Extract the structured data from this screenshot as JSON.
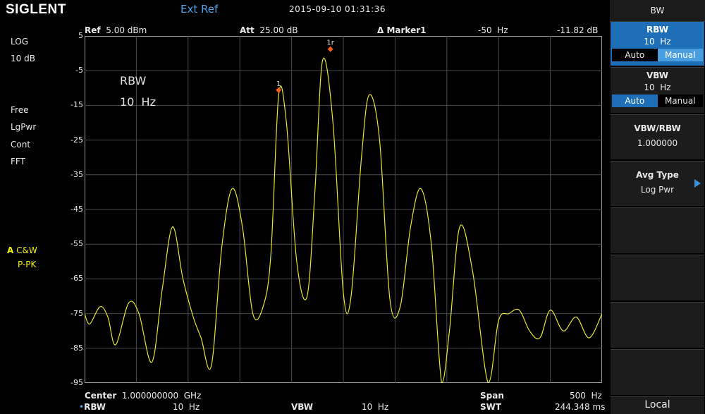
{
  "header": {
    "logo": "SIGLENT",
    "ref_source": "Ext Ref",
    "datetime": "2015-09-10   01:31:36"
  },
  "info_bar": {
    "ref_label": "Ref",
    "ref_value": "5.00 dBm",
    "att_label": "Att",
    "att_value": "25.00 dB",
    "marker_label": "Δ Marker1",
    "marker_freq": "-50  Hz",
    "marker_amp": "-11.82 dB"
  },
  "left_panel": {
    "scale_type": "LOG",
    "scale_div": "10 dB",
    "trig": "Free",
    "det": "LgPwr",
    "sweep": "Cont",
    "mode": "FFT",
    "trace_letter": "A",
    "trace_mode": "C&W",
    "trace_det": "P-PK"
  },
  "plot_overlay": {
    "rbw_label": "RBW",
    "rbw_value": "10  Hz"
  },
  "chart_data": {
    "type": "line",
    "ylabel": "",
    "xlabel": "",
    "yticks": [
      "5",
      "-5",
      "-15",
      "-25",
      "-35",
      "-45",
      "-55",
      "-65",
      "-75",
      "-85",
      "-95"
    ],
    "ylim": [
      -95,
      5
    ],
    "xlim": [
      0,
      10
    ],
    "grid": true,
    "series": [
      {
        "color": "#e6e62a",
        "x": [
          0,
          0.1,
          0.3,
          0.45,
          0.6,
          0.85,
          1.05,
          1.3,
          1.5,
          1.7,
          1.9,
          2.1,
          2.25,
          2.45,
          2.65,
          2.85,
          3.05,
          3.25,
          3.45,
          3.6,
          3.75,
          3.9,
          4.1,
          4.3,
          4.45,
          4.6,
          4.8,
          5,
          5.15,
          5.35,
          5.5,
          5.7,
          5.9,
          6.1,
          6.3,
          6.5,
          6.7,
          6.9,
          7.05,
          7.25,
          7.5,
          7.8,
          8.0,
          8.2,
          8.4,
          8.6,
          8.8,
          9.0,
          9.25,
          9.5,
          9.75,
          10
        ],
        "y": [
          -75,
          -78,
          -73,
          -76,
          -84,
          -72,
          -75,
          -89,
          -68,
          -50,
          -65,
          -76,
          -82,
          -90,
          -56,
          -39,
          -50,
          -75,
          -73,
          -58,
          -12,
          -20,
          -60,
          -70,
          -40,
          -2,
          -20,
          -69,
          -70,
          -30,
          -12,
          -25,
          -71,
          -73,
          -50,
          -39,
          -55,
          -99,
          -80,
          -50,
          -63,
          -99,
          -77,
          -75,
          -74,
          -80,
          -82,
          -74,
          -80,
          -76,
          -82,
          -75
        ]
      }
    ],
    "markers": [
      {
        "label": "1",
        "x": 3.75,
        "y": -11.82
      },
      {
        "label": "1r",
        "x": 4.75,
        "y": 0.0
      }
    ]
  },
  "bottom_bar": {
    "center_label": "Center",
    "center_value": "1.000000000  GHz",
    "span_label": "Span",
    "span_value": "500  Hz",
    "rbw_label": "RBW",
    "rbw_value": "10  Hz",
    "vbw_label": "VBW",
    "vbw_value": "10  Hz",
    "swt_label": "SWT",
    "swt_value": "244.348 ms"
  },
  "softkeys": {
    "menu_title": "BW",
    "rbw_title": "RBW",
    "rbw_value": "10  Hz",
    "rbw_auto": "Auto",
    "rbw_manual": "Manual",
    "vbw_title": "VBW",
    "vbw_value": "10  Hz",
    "vbw_auto": "Auto",
    "vbw_manual": "Manual",
    "ratio_title": "VBW/RBW",
    "ratio_value": "1.000000",
    "avg_title": "Avg Type",
    "avg_value": "Log Pwr",
    "local": "Local"
  },
  "colors": {
    "accent": "#1e6fb8",
    "trace": "#e6e62a",
    "marker": "#ff5a1a",
    "extref": "#4aa3e8"
  }
}
